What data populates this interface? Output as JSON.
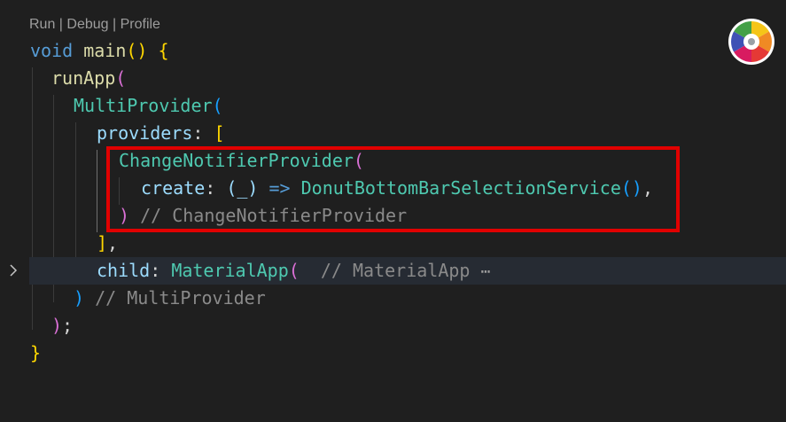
{
  "codelens": {
    "text": "Run | Debug | Profile"
  },
  "code": {
    "l1": {
      "kw": "void",
      "fn": "main",
      "open": "()",
      "brace": " {"
    },
    "l2": {
      "fn": "runApp",
      "open": "("
    },
    "l3": {
      "cls": "MultiProvider",
      "open": "("
    },
    "l4": {
      "prop": "providers",
      "colon": ": ",
      "open": "["
    },
    "l5": {
      "cls": "ChangeNotifierProvider",
      "open": "("
    },
    "l6": {
      "prop": "create",
      "colon": ": ",
      "args": "(_)",
      "arrow": " => ",
      "cls": "DonutBottomBarSelectionService",
      "call": "()",
      "comma": ","
    },
    "l7": {
      "close": ")",
      "comment": " // ChangeNotifierProvider"
    },
    "l8": {
      "close": "]",
      "comma": ","
    },
    "l9": {
      "prop": "child",
      "colon": ": ",
      "cls": "MaterialApp",
      "open": "(",
      "comment": "  // MaterialApp",
      "ellipsis": "⋯"
    },
    "l10": {
      "close": ")",
      "comment": " // MultiProvider"
    },
    "l11": {
      "close": ")",
      "semi": ";"
    },
    "l12": {
      "close": "}"
    }
  },
  "icons": {
    "fold": "chevron-right-icon",
    "extension": "color-wheel-icon"
  },
  "colors": {
    "background": "#1f1f1f",
    "highlight_box": "#e10000",
    "keyword": "#569cd6",
    "function": "#dcdcaa",
    "class": "#4ec9b0",
    "property": "#9cdcfe",
    "comment": "#8a8a8a"
  }
}
